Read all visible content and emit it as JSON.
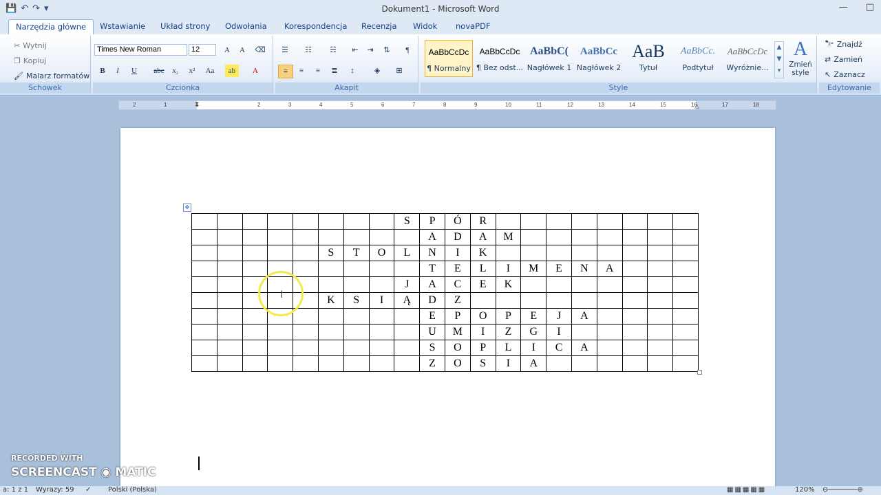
{
  "window": {
    "title": "Dokument1 - Microsoft Word",
    "controls": [
      "—",
      "□"
    ]
  },
  "qat": {
    "save": "💾",
    "undo": "↶",
    "redo": "↷",
    "more": "▾"
  },
  "tabs": [
    {
      "label": "Narzędzia główne",
      "active": true
    },
    {
      "label": "Wstawianie"
    },
    {
      "label": "Układ strony"
    },
    {
      "label": "Odwołania"
    },
    {
      "label": "Korespondencja"
    },
    {
      "label": "Recenzja"
    },
    {
      "label": "Widok"
    },
    {
      "label": "novaPDF"
    }
  ],
  "clipboard": {
    "cut": "Wytnij",
    "copy": "Kopiuj",
    "painter": "Malarz formatów",
    "label": "Schowek"
  },
  "font": {
    "name": "Times New Roman",
    "size": "12",
    "label": "Czcionka"
  },
  "paragraph": {
    "label": "Akapit"
  },
  "styles": {
    "label": "Style",
    "items": [
      {
        "preview": "AaBbCcDc",
        "name": "¶ Normalny",
        "selected": true
      },
      {
        "preview": "AaBbCcDc",
        "name": "¶ Bez odst..."
      },
      {
        "preview": "AaBbC(",
        "name": "Nagłówek 1"
      },
      {
        "preview": "AaBbCc",
        "name": "Nagłówek 2"
      },
      {
        "preview": "AaB",
        "name": "Tytuł"
      },
      {
        "preview": "AaBbCc.",
        "name": "Podtytuł"
      },
      {
        "preview": "AaBbCcDc",
        "name": "Wyróżnie..."
      }
    ],
    "change": "Zmień style"
  },
  "editing": {
    "find": "Znajdź",
    "replace": "Zamień",
    "select": "Zaznacz",
    "label": "Edytowanie"
  },
  "ruler": {
    "numbers": [
      "2",
      "1",
      "1",
      "2",
      "3",
      "4",
      "5",
      "6",
      "7",
      "8",
      "9",
      "10",
      "11",
      "12",
      "13",
      "14",
      "15",
      "16",
      "17",
      "18"
    ]
  },
  "crossword": {
    "rows": [
      [
        "",
        "",
        "",
        "",
        "",
        "",
        "",
        "",
        "S",
        "P",
        "Ó",
        "R",
        "",
        "",
        "",
        "",
        "",
        "",
        "",
        ""
      ],
      [
        "",
        "",
        "",
        "",
        "",
        "",
        "",
        "",
        "",
        "A",
        "D",
        "A",
        "M",
        "",
        "",
        "",
        "",
        "",
        "",
        ""
      ],
      [
        "",
        "",
        "",
        "",
        "",
        "S",
        "T",
        "O",
        "L",
        "N",
        "I",
        "K",
        "",
        "",
        "",
        "",
        "",
        "",
        "",
        ""
      ],
      [
        "",
        "",
        "",
        "",
        "",
        "",
        "",
        "",
        "",
        "T",
        "E",
        "L",
        "I",
        "M",
        "E",
        "N",
        "A",
        "",
        "",
        ""
      ],
      [
        "",
        "",
        "",
        "",
        "",
        "",
        "",
        "",
        "J",
        "A",
        "C",
        "E",
        "K",
        "",
        "",
        "",
        "",
        "",
        "",
        ""
      ],
      [
        "",
        "",
        "",
        "",
        "",
        "K",
        "S",
        "I",
        "Ą",
        "D",
        "Z",
        "",
        "",
        "",
        "",
        "",
        "",
        "",
        "",
        ""
      ],
      [
        "",
        "",
        "",
        "",
        "",
        "",
        "",
        "",
        "",
        "E",
        "P",
        "O",
        "P",
        "E",
        "J",
        "A",
        "",
        "",
        "",
        ""
      ],
      [
        "",
        "",
        "",
        "",
        "",
        "",
        "",
        "",
        "",
        "U",
        "M",
        "I",
        "Z",
        "G",
        "I",
        "",
        "",
        "",
        "",
        ""
      ],
      [
        "",
        "",
        "",
        "",
        "",
        "",
        "",
        "",
        "",
        "S",
        "O",
        "P",
        "L",
        "I",
        "C",
        "A",
        "",
        "",
        "",
        ""
      ],
      [
        "",
        "",
        "",
        "",
        "",
        "",
        "",
        "",
        "",
        "Z",
        "O",
        "S",
        "I",
        "A",
        "",
        "",
        "",
        "",
        "",
        ""
      ]
    ]
  },
  "status": {
    "page": "a: 1 z 1",
    "words": "Wyrazy: 59",
    "lang": "Polski (Polska)",
    "zoom": "120%"
  },
  "watermark": {
    "line1": "RECORDED WITH",
    "line2": "SCREENCAST ◉ MATIC"
  }
}
